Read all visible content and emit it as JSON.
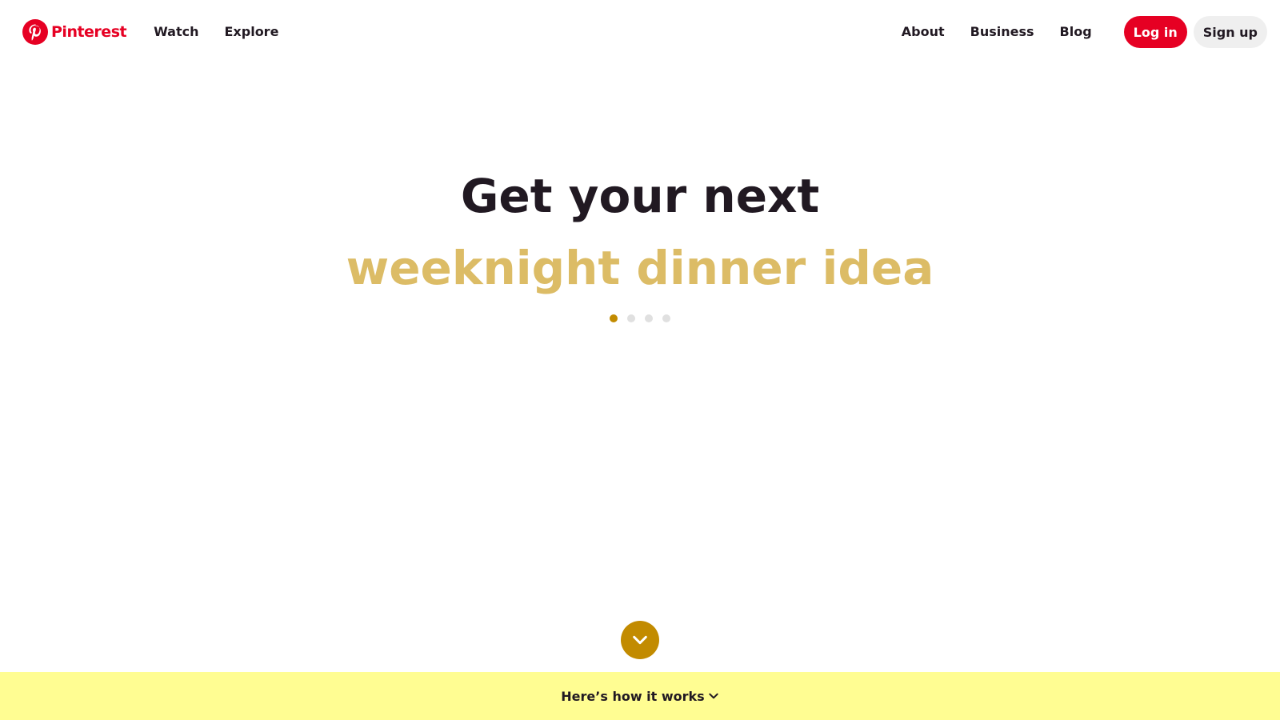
{
  "brand": {
    "name": "Pinterest",
    "color": "#e60023"
  },
  "nav": {
    "left": [
      {
        "label": "Watch"
      },
      {
        "label": "Explore"
      }
    ],
    "right": [
      {
        "label": "About"
      },
      {
        "label": "Business"
      },
      {
        "label": "Blog"
      }
    ],
    "login_label": "Log in",
    "signup_label": "Sign up"
  },
  "hero": {
    "line1": "Get your next",
    "line2": "weeknight dinner idea",
    "line2_color": "#dcbc66",
    "carousel": {
      "count": 4,
      "active_index": 0,
      "active_color": "#c28b00"
    }
  },
  "scroll_button": {
    "icon": "chevron-down-icon",
    "color": "#c28b00"
  },
  "banner": {
    "label": "Here’s how it works",
    "icon": "chevron-down-icon",
    "background": "#fffd92"
  }
}
